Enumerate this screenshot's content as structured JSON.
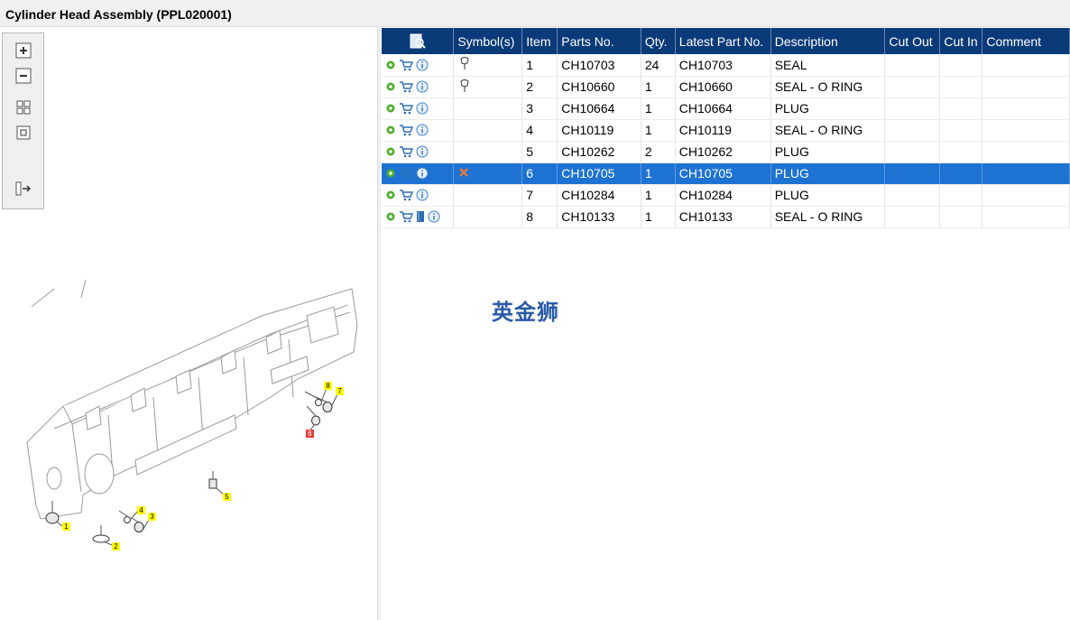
{
  "window": {
    "title": "Cylinder Head Assembly (PPL020001)"
  },
  "toolbox": {
    "buttons": [
      "zoom-in-icon",
      "zoom-out-icon",
      "fit-all-icon",
      "fit-window-icon",
      "export-icon"
    ]
  },
  "table": {
    "columns": [
      "Symbol(s)",
      "Item",
      "Parts No.",
      "Qty.",
      "Latest Part No.",
      "Description",
      "Cut Out",
      "Cut In",
      "Comment"
    ],
    "rows": [
      {
        "symbol": "pin-icon",
        "item": "1",
        "part": "CH10703",
        "qty": "24",
        "latest": "CH10703",
        "desc": "SEAL",
        "cutout": "",
        "cutin": "",
        "comment": "",
        "book": false,
        "selected": false
      },
      {
        "symbol": "pin-icon",
        "item": "2",
        "part": "CH10660",
        "qty": "1",
        "latest": "CH10660",
        "desc": "SEAL - O RING",
        "cutout": "",
        "cutin": "",
        "comment": "",
        "book": false,
        "selected": false
      },
      {
        "symbol": "",
        "item": "3",
        "part": "CH10664",
        "qty": "1",
        "latest": "CH10664",
        "desc": "PLUG",
        "cutout": "",
        "cutin": "",
        "comment": "",
        "book": false,
        "selected": false
      },
      {
        "symbol": "",
        "item": "4",
        "part": "CH10119",
        "qty": "1",
        "latest": "CH10119",
        "desc": "SEAL - O RING",
        "cutout": "",
        "cutin": "",
        "comment": "",
        "book": false,
        "selected": false
      },
      {
        "symbol": "",
        "item": "5",
        "part": "CH10262",
        "qty": "2",
        "latest": "CH10262",
        "desc": "PLUG",
        "cutout": "",
        "cutin": "",
        "comment": "",
        "book": false,
        "selected": false
      },
      {
        "symbol": "cross-icon",
        "item": "6",
        "part": "CH10705",
        "qty": "1",
        "latest": "CH10705",
        "desc": "PLUG",
        "cutout": "",
        "cutin": "",
        "comment": "",
        "book": false,
        "selected": true
      },
      {
        "symbol": "",
        "item": "7",
        "part": "CH10284",
        "qty": "1",
        "latest": "CH10284",
        "desc": "PLUG",
        "cutout": "",
        "cutin": "",
        "comment": "",
        "book": false,
        "selected": false
      },
      {
        "symbol": "",
        "item": "8",
        "part": "CH10133",
        "qty": "1",
        "latest": "CH10133",
        "desc": "SEAL - O RING",
        "cutout": "",
        "cutin": "",
        "comment": "",
        "book": true,
        "selected": false
      }
    ]
  },
  "watermark": "英金狮",
  "diagram": {
    "callouts": [
      "1",
      "2",
      "3",
      "4",
      "5",
      "6",
      "7",
      "8"
    ],
    "highlighted_callout": "6"
  },
  "colors": {
    "header": "#0a3a78",
    "selected_row": "#1e73d2",
    "callout": "#ffff00",
    "callout_highlight": "#e23b3b"
  }
}
